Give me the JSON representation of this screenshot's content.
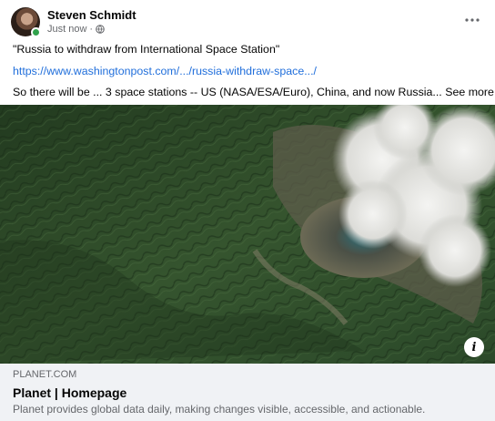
{
  "post": {
    "author": "Steven Schmidt",
    "timestamp": "Just now",
    "separator": "·",
    "privacy_icon": "globe-icon",
    "more_icon": "more-horizontal-icon",
    "online_color": "#31a24c"
  },
  "text": {
    "line1": "\"Russia to withdraw from International Space Station\"",
    "line2": "https://www.washingtonpost.com/.../russia-withdraw-space.../",
    "line3": "So there will be ... 3 space stations -- US (NASA/ESA/Euro), China, and now Russia...",
    "see_more": "See more",
    "link_color": "#216fdb"
  },
  "media": {
    "info_icon": "info-icon",
    "info_label": "i"
  },
  "link_preview": {
    "domain": "PLANET.COM",
    "title": "Planet | Homepage",
    "description": "Planet provides global data daily, making changes visible, accessible, and actionable."
  }
}
